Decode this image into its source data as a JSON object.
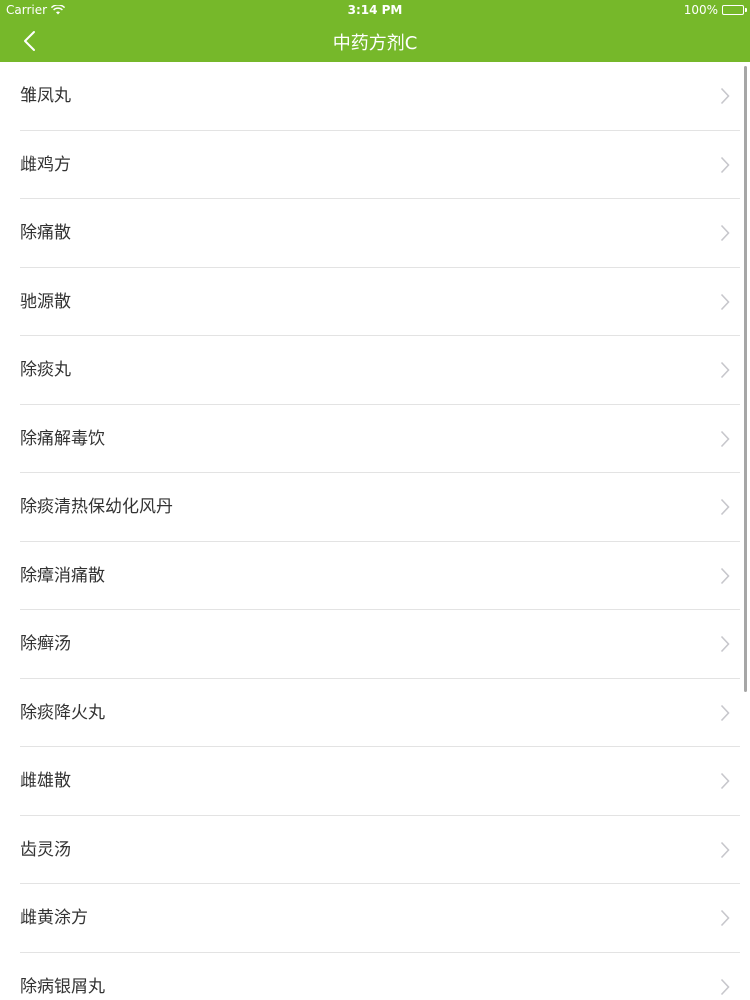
{
  "status_bar": {
    "carrier": "Carrier",
    "time": "3:14 PM",
    "battery": "100%"
  },
  "nav": {
    "title": "中药方剂C",
    "back_icon": "chevron-left-icon"
  },
  "colors": {
    "accent": "#76b82a",
    "separator": "#e3e3e3",
    "text": "#333333",
    "chevron": "#c7c7cc"
  },
  "list": {
    "items": [
      {
        "label": "雏凤丸"
      },
      {
        "label": "雌鸡方"
      },
      {
        "label": "除痛散"
      },
      {
        "label": "驰源散"
      },
      {
        "label": "除痰丸"
      },
      {
        "label": "除痛解毒饮"
      },
      {
        "label": "除痰清热保幼化风丹"
      },
      {
        "label": "除瘴消痛散"
      },
      {
        "label": "除癣汤"
      },
      {
        "label": "除痰降火丸"
      },
      {
        "label": "雌雄散"
      },
      {
        "label": "齿灵汤"
      },
      {
        "label": "雌黄涂方"
      },
      {
        "label": "除病银屑丸"
      }
    ]
  }
}
